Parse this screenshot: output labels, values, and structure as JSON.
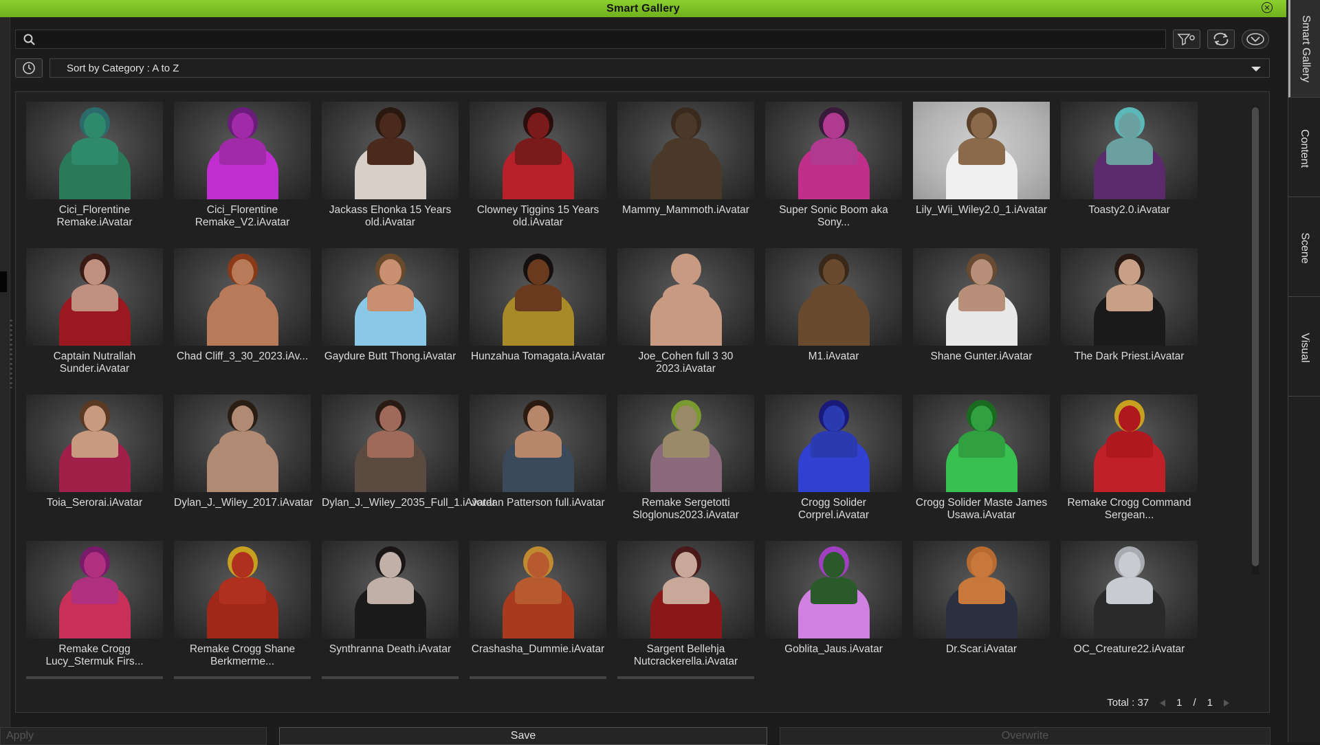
{
  "window": {
    "title": "Smart Gallery"
  },
  "side_tabs": [
    "Smart Gallery",
    "Content",
    "Scene",
    "Visual"
  ],
  "search": {
    "value": "",
    "placeholder": ""
  },
  "sort": {
    "label": "Sort by Category : A to Z"
  },
  "colors": {
    "title_bar": "#7cc022",
    "panel": "#202020",
    "background": "#1c1c1c"
  },
  "items": [
    {
      "caption": "Cici_Florentine Remake.iAvatar",
      "skin": "#2f8a6c",
      "hair": "#2c6b6b",
      "cloth": "#2a7a5a"
    },
    {
      "caption": "Cici_Florentine Remake_V2.iAvatar",
      "skin": "#a12aa8",
      "hair": "#6b1b7a",
      "cloth": "#c02ed0"
    },
    {
      "caption": "Jackass Ehonka 15 Years old.iAvatar",
      "skin": "#4a2a1c",
      "hair": "#2a1810",
      "cloth": "#d8d0c8"
    },
    {
      "caption": "Clowney Tiggins 15 Years old.iAvatar",
      "skin": "#7a1a1a",
      "hair": "#2a0e0e",
      "cloth": "#b8202a"
    },
    {
      "caption": "Mammy_Mammoth.iAvatar",
      "skin": "#4a3828",
      "hair": "#3a2a1e",
      "cloth": "#4a3828"
    },
    {
      "caption": "Super Sonic Boom aka Sony...",
      "skin": "#b03a90",
      "hair": "#3a1a3a",
      "cloth": "#c0308a"
    },
    {
      "caption": "Lily_Wii_Wiley2.0_1.iAvatar",
      "skin": "#8a6a4a",
      "hair": "#5a4028",
      "cloth": "#f0f0f0",
      "bright": true
    },
    {
      "caption": "Toasty2.0.iAvatar",
      "skin": "#6aa0a0",
      "hair": "#5ab8b8",
      "cloth": "#5a2a6a"
    },
    {
      "caption": "Captain Nutrallah Sunder.iAvatar",
      "skin": "#c09080",
      "hair": "#3a1a14",
      "cloth": "#9a1820"
    },
    {
      "caption": "Chad Cliff_3_30_2023.iAv...",
      "skin": "#b87a58",
      "hair": "#8a3a18",
      "cloth": "#b87a58"
    },
    {
      "caption": "Gaydure Butt Thong.iAvatar",
      "skin": "#c89070",
      "hair": "#6a4a2a",
      "cloth": "#8ac8e8"
    },
    {
      "caption": "Hunzahua Tomagata.iAvatar",
      "skin": "#6a3a1e",
      "hair": "#151010",
      "cloth": "#a88a28"
    },
    {
      "caption": "Joe_Cohen full 3 30 2023.iAvatar",
      "skin": "#c89a82",
      "hair": "#c89a82",
      "cloth": "#c89a82"
    },
    {
      "caption": "M1.iAvatar",
      "skin": "#6a4a2e",
      "hair": "#3a2818",
      "cloth": "#6a4a2e"
    },
    {
      "caption": "Shane Gunter.iAvatar",
      "skin": "#b8907a",
      "hair": "#6a4a30",
      "cloth": "#e8e8e8"
    },
    {
      "caption": "The Dark Priest.iAvatar",
      "skin": "#c8a088",
      "hair": "#2a1a14",
      "cloth": "#1a1a1a"
    },
    {
      "caption": "Toia_Serorai.iAvatar",
      "skin": "#c89a80",
      "hair": "#5a3a22",
      "cloth": "#a0204a"
    },
    {
      "caption": "Dylan_J._Wiley_2017.iAvatar",
      "skin": "#b08a72",
      "hair": "#2a1e14",
      "cloth": "#b08a72"
    },
    {
      "caption": "Dylan_J._Wiley_2035_Full_1.iAvatar",
      "skin": "#a06a5a",
      "hair": "#2a1a14",
      "cloth": "#5a4a40"
    },
    {
      "caption": "Jordan Patterson full.iAvatar",
      "skin": "#b8866a",
      "hair": "#2a1a10",
      "cloth": "#3a4a5a"
    },
    {
      "caption": "Remake Sergetotti Sloglonus2023.iAvatar",
      "skin": "#9a8a6a",
      "hair": "#7a9a30",
      "cloth": "#8a6a7a"
    },
    {
      "caption": "Crogg Solider Corprel.iAvatar",
      "skin": "#2a3ab0",
      "hair": "#1a1a7a",
      "cloth": "#3040d0"
    },
    {
      "caption": "Crogg Solider Maste James Usawa.iAvatar",
      "skin": "#30a040",
      "hair": "#1a6a20",
      "cloth": "#38c050"
    },
    {
      "caption": "Remake Crogg Command Sergean...",
      "skin": "#b01820",
      "hair": "#c8a020",
      "cloth": "#c02028"
    },
    {
      "caption": "Remake Crogg Lucy_Stermuk Firs...",
      "skin": "#b03080",
      "hair": "#7a1a6a",
      "cloth": "#c8305a"
    },
    {
      "caption": "Remake Crogg Shane Berkmerme...",
      "skin": "#b03020",
      "hair": "#c8a020",
      "cloth": "#a02818"
    },
    {
      "caption": "Synthranna Death.iAvatar",
      "skin": "#c0b0a8",
      "hair": "#1a1616",
      "cloth": "#1a1a1a"
    },
    {
      "caption": "Crashasha_Dummie.iAvatar",
      "skin": "#b85a30",
      "hair": "#c08a30",
      "cloth": "#a83a1e"
    },
    {
      "caption": "Sargent Bellehja Nutcrackerella.iAvatar",
      "skin": "#c8a898",
      "hair": "#4a1a1a",
      "cloth": "#8a1818"
    },
    {
      "caption": "Goblita_Jaus.iAvatar",
      "skin": "#2a5a2a",
      "hair": "#a040c0",
      "cloth": "#d080e0"
    },
    {
      "caption": "Dr.Scar.iAvatar",
      "skin": "#c8783a",
      "hair": "#b86a30",
      "cloth": "#2a3040"
    },
    {
      "caption": "OC_Creature22.iAvatar",
      "skin": "#c8ccd0",
      "hair": "#a8acb0",
      "cloth": "#2a2a2a"
    }
  ],
  "footer": {
    "total": "Total : 37",
    "page_current": "1",
    "page_sep": "/",
    "page_total": "1",
    "apply_label": "Apply",
    "save_label": "Save",
    "overwrite_label": "Overwrite"
  }
}
